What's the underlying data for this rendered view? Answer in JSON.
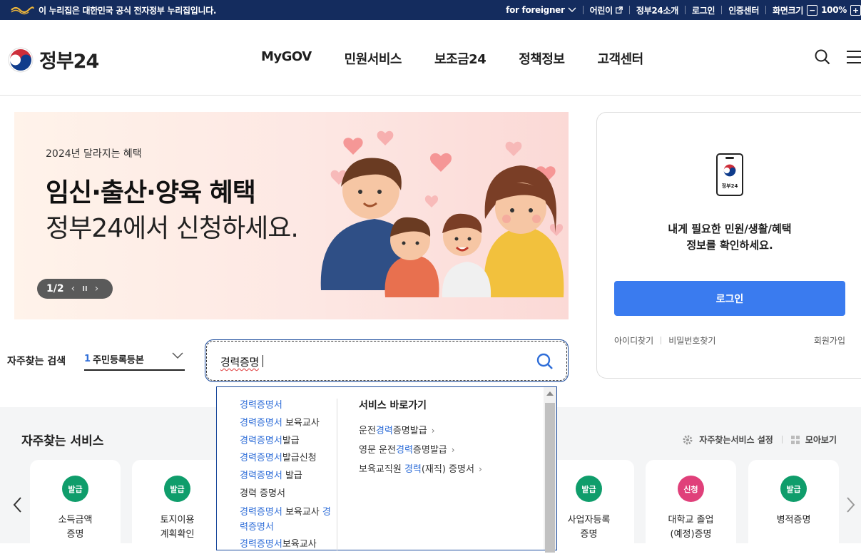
{
  "topbar": {
    "notice": "이 누리집은 대한민국 공식 전자정부 누리집입니다.",
    "links": [
      "for foreigner",
      "어린이",
      "정부24소개",
      "로그인",
      "인증센터"
    ],
    "zoom_label": "화면크기",
    "zoom_value": "100%",
    "zoom_minus": "−",
    "zoom_plus": "+"
  },
  "header": {
    "logo_text": "정부24",
    "nav": [
      "MyGOV",
      "민원서비스",
      "보조금24",
      "정책정보",
      "고객센터"
    ]
  },
  "banner": {
    "year_label": "2024년 달라지는 혜택",
    "headline": "임신·출산·양육 혜택",
    "subheadline": "정부24에서 신청하세요.",
    "pager": "1/2",
    "pager_prev": "‹",
    "pager_pause": "II",
    "pager_next": "›"
  },
  "login": {
    "phone_label": "정부24",
    "message_line1": "내게 필요한 민원/생활/혜택",
    "message_line2": "정보를 확인하세요.",
    "button": "로그인",
    "find_id": "아이디찾기",
    "find_pw": "비밀번호찾기",
    "signup": "회원가입"
  },
  "search": {
    "frequent_label": "자주찾는 검색",
    "frequent_rank": "1",
    "frequent_value": "주민등록등본",
    "query": "경력증명"
  },
  "autocomplete": {
    "suggestions": [
      {
        "hl": "경력증명서",
        "rest": ""
      },
      {
        "hl": "경력증명서",
        "rest": " 보육교사"
      },
      {
        "hl": "경력증명서",
        "rest": "발급"
      },
      {
        "hl": "경력증명서",
        "rest": "발급신청"
      },
      {
        "hl": "경력증명서",
        "rest": " 발급"
      },
      {
        "hl": "",
        "rest": "경력 증명서"
      },
      {
        "hl": "경력증명서",
        "rest": " 보육교사 ",
        "hl2": "경력증명서"
      },
      {
        "hl": "경력증명서",
        "rest": "보육교사"
      }
    ],
    "shortcut_title": "서비스 바로가기",
    "shortcuts": [
      {
        "pre": "운전",
        "hl": "경력",
        "post": "증명발급"
      },
      {
        "pre": "영문 운전",
        "hl": "경력",
        "post": "증명발급"
      },
      {
        "pre": "보육교직원 ",
        "hl": "경력",
        "post": "(재직) 증명서"
      }
    ]
  },
  "services": {
    "title": "자주찾는 서비스",
    "settings": "자주찾는서비스 설정",
    "view_all": "모아보기",
    "cards": [
      {
        "badge": "발급",
        "line1": "소득금액",
        "line2": "증명",
        "color": "#0f9d6b"
      },
      {
        "badge": "발급",
        "line1": "토지이용",
        "line2": "계획확인",
        "color": "#0f9d6b"
      },
      {
        "badge": "발급",
        "line1": "사업자등록",
        "line2": "증명",
        "color": "#0f9d6b"
      },
      {
        "badge": "신청",
        "line1": "대학교 졸업",
        "line2": "(예정)증명",
        "color": "#e0407a"
      },
      {
        "badge": "발급",
        "line1": "병적증명",
        "line2": "",
        "color": "#0f9d6b"
      }
    ]
  },
  "colors": {
    "topbar": "#142c5e",
    "accent": "#3a7bef",
    "highlight": "#2f6ed8"
  }
}
